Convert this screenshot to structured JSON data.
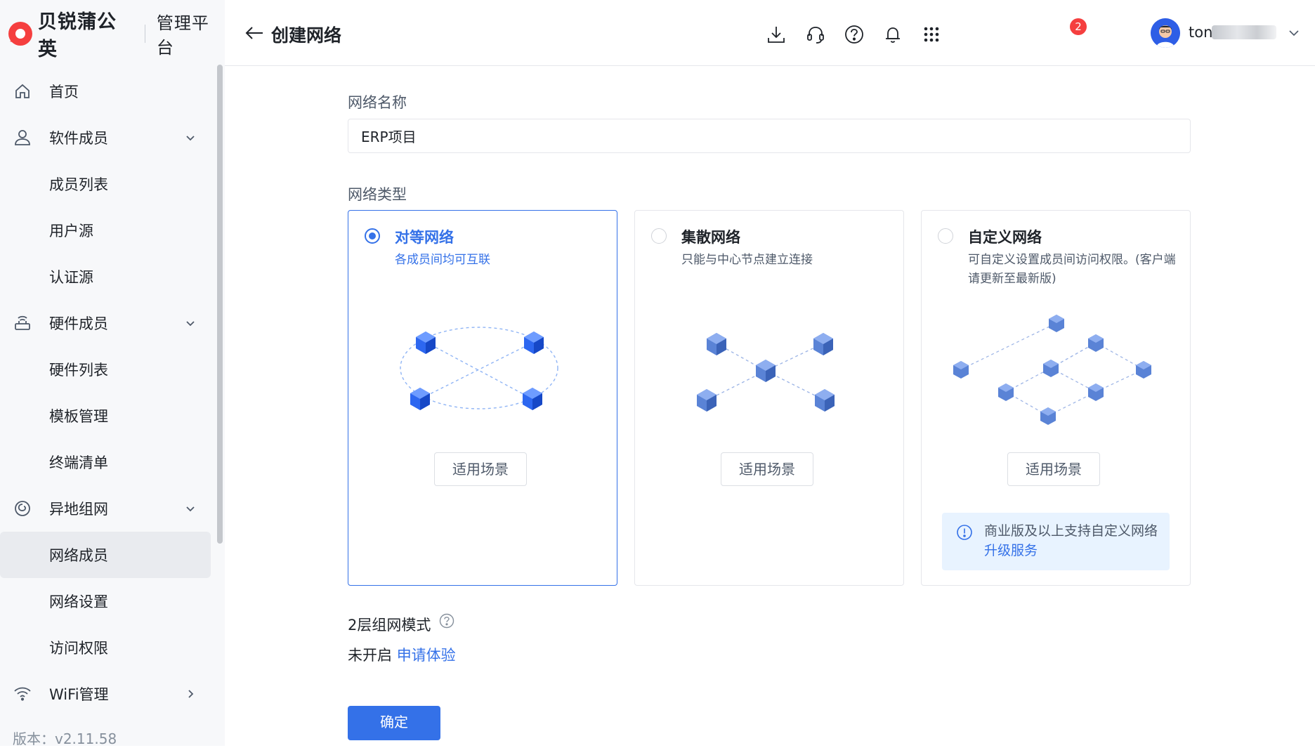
{
  "brand": {
    "name": "贝锐蒲公英",
    "subtitle": "管理平台",
    "logo_color": "#f53f3f"
  },
  "sidebar": {
    "items": [
      {
        "label": "首页",
        "icon": "home-icon",
        "type": "top"
      },
      {
        "label": "软件成员",
        "icon": "user-icon",
        "type": "group",
        "arrow": "chevron-down-icon"
      },
      {
        "label": "成员列表",
        "type": "sub"
      },
      {
        "label": "用户源",
        "type": "sub"
      },
      {
        "label": "认证源",
        "type": "sub"
      },
      {
        "label": "硬件成员",
        "icon": "router-icon",
        "type": "group",
        "arrow": "chevron-down-icon"
      },
      {
        "label": "硬件列表",
        "type": "sub"
      },
      {
        "label": "模板管理",
        "type": "sub"
      },
      {
        "label": "终端清单",
        "type": "sub"
      },
      {
        "label": "异地组网",
        "icon": "network-icon",
        "type": "group",
        "arrow": "chevron-down-icon"
      },
      {
        "label": "网络成员",
        "type": "sub",
        "active": true
      },
      {
        "label": "网络设置",
        "type": "sub"
      },
      {
        "label": "访问权限",
        "type": "sub"
      },
      {
        "label": "WiFi管理",
        "icon": "wifi-icon",
        "type": "group",
        "arrow": "chevron-right-icon"
      }
    ],
    "version": "版本：v2.11.58"
  },
  "header": {
    "title": "创建网络",
    "icons": [
      "download-icon",
      "headset-icon",
      "help-circle-icon",
      "bell-icon",
      "apps-grid-icon"
    ],
    "notification_count": "2",
    "username": "ton"
  },
  "form": {
    "name_label": "网络名称",
    "name_value": "ERP项目",
    "type_label": "网络类型",
    "cards": [
      {
        "title": "对等网络",
        "desc": "各成员间均可互联",
        "selected": true,
        "button": "适用场景"
      },
      {
        "title": "集散网络",
        "desc": "只能与中心节点建立连接",
        "selected": false,
        "button": "适用场景"
      },
      {
        "title": "自定义网络",
        "desc": "可自定义设置成员间访问权限。(客户端请更新至最新版)",
        "selected": false,
        "button": "适用场景"
      }
    ],
    "upgrade_tip": {
      "text": "商业版及以上支持自定义网络 ",
      "link": "升级服务"
    },
    "layer_mode_label": "2层组网模式",
    "layer_status": "未开启",
    "layer_link": "申请体验",
    "confirm": "确定"
  },
  "colors": {
    "accent": "#3471e8",
    "badge": "#f53f3f",
    "tip_bg": "#e8f3ff",
    "sidebar_bg": "#f7f8fa"
  }
}
